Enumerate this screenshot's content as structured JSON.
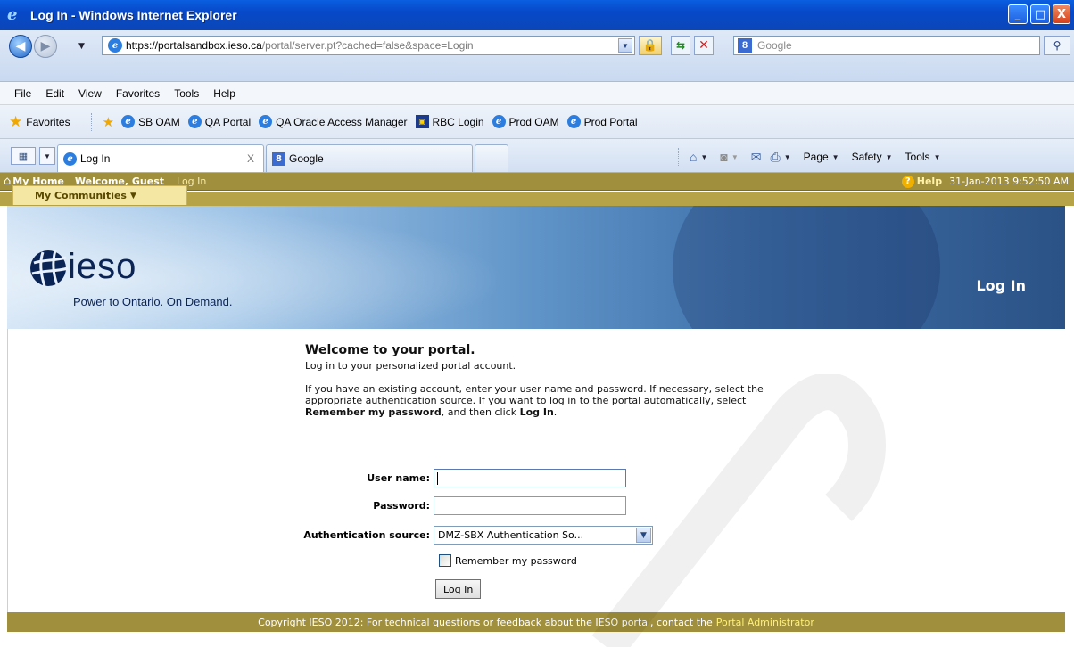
{
  "window": {
    "title": "Log In - Windows Internet Explorer",
    "minimize": "_",
    "maximize": "□",
    "close": "X"
  },
  "address": {
    "url_scheme": "https://",
    "url_host": "portalsandbox.ieso.ca",
    "url_path": "/portal/server.pt?cached=false&space=Login"
  },
  "search": {
    "placeholder": "Google"
  },
  "menu": [
    "File",
    "Edit",
    "View",
    "Favorites",
    "Tools",
    "Help"
  ],
  "favorites": {
    "label": "Favorites",
    "items": [
      {
        "label": "SB OAM",
        "icon": "ie-page-icon"
      },
      {
        "label": "QA Portal",
        "icon": "ie-page-icon"
      },
      {
        "label": "QA Oracle Access Manager",
        "icon": "ie-page-icon"
      },
      {
        "label": "RBC Login",
        "icon": "rbc-icon"
      },
      {
        "label": "Prod OAM",
        "icon": "ie-page-icon"
      },
      {
        "label": "Prod Portal",
        "icon": "ie-page-icon"
      }
    ]
  },
  "tabs": [
    {
      "label": "Log In",
      "active": true
    },
    {
      "label": "Google",
      "active": false
    }
  ],
  "commands": {
    "page": "Page",
    "safety": "Safety",
    "tools": "Tools"
  },
  "portal": {
    "my_home": "My Home",
    "welcome": "Welcome, Guest",
    "login_link": "Log In",
    "help": "Help",
    "datetime": "31-Jan-2013 9:52:50 AM",
    "communities": "My Communities",
    "brand": "ieso",
    "tagline": "Power to Ontario. On Demand.",
    "page_title": "Log In"
  },
  "login": {
    "heading": "Welcome to your portal.",
    "intro": "Log in to your personalized portal account.",
    "instructions_1": "If you have an existing account, enter your user name and password. If necessary, select the appropriate authentication source. If you want to log in to the portal automatically, select",
    "instructions_bold_1": "Remember my password",
    "instructions_2": ", and then click",
    "instructions_bold_2": "Log In",
    "instructions_3": ".",
    "username_label": "User name:",
    "password_label": "Password:",
    "auth_label": "Authentication source:",
    "auth_value": "DMZ-SBX Authentication So...",
    "remember_label": "Remember my password",
    "submit_label": "Log In",
    "username_value": "",
    "password_value": "",
    "remember_checked": false
  },
  "footer": {
    "text": "Copyright IESO 2012: For technical questions or feedback about the IESO portal, contact the",
    "link": "Portal Administrator"
  },
  "colors": {
    "title_bar": "#0648c8",
    "portal_gold": "#a08f3c",
    "community_tab": "#f4e7a4",
    "footer_link": "#fff07a",
    "ieso_navy": "#0b2456"
  }
}
